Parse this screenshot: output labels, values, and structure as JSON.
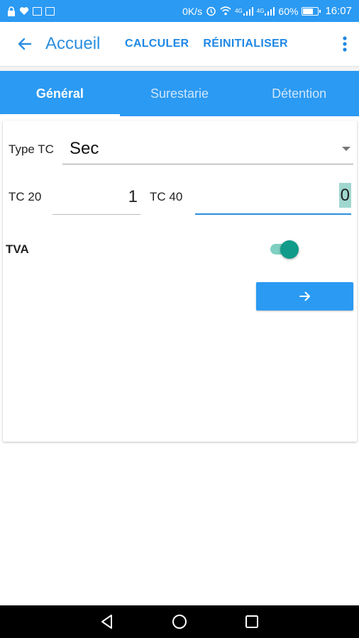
{
  "status_bar": {
    "network_speed": "0K/s",
    "signal_label_1": "4G",
    "signal_label_2": "4G",
    "battery": "60%",
    "time": "16:07",
    "icons": [
      "lock-icon",
      "heart-icon",
      "photo-icon",
      "mail-icon",
      "alarm-icon",
      "wifi-icon",
      "signal-icon",
      "battery-icon"
    ]
  },
  "app_bar": {
    "title": "Accueil",
    "calculate_label": "CALCULER",
    "reset_label": "RÉINITIALISER",
    "back_icon": "arrow-left-icon",
    "more_icon": "more-vert-icon"
  },
  "tabs": [
    {
      "label": "Général",
      "active": true
    },
    {
      "label": "Surestarie",
      "active": false
    },
    {
      "label": "Détention",
      "active": false
    }
  ],
  "form": {
    "type_label": "Type TC",
    "type_value": "Sec",
    "tc20_label": "TC 20",
    "tc20_value": "1",
    "tc40_label": "TC 40",
    "tc40_value": "0",
    "tva_label": "TVA",
    "tva_enabled": true,
    "next_icon": "arrow-right-icon"
  },
  "colors": {
    "primary": "#2b9af3",
    "accent": "#0f9a8a",
    "title": "#2b8fe0"
  },
  "nav_bar": {
    "icons": [
      "back-triangle-icon",
      "home-circle-icon",
      "recents-square-icon"
    ]
  }
}
